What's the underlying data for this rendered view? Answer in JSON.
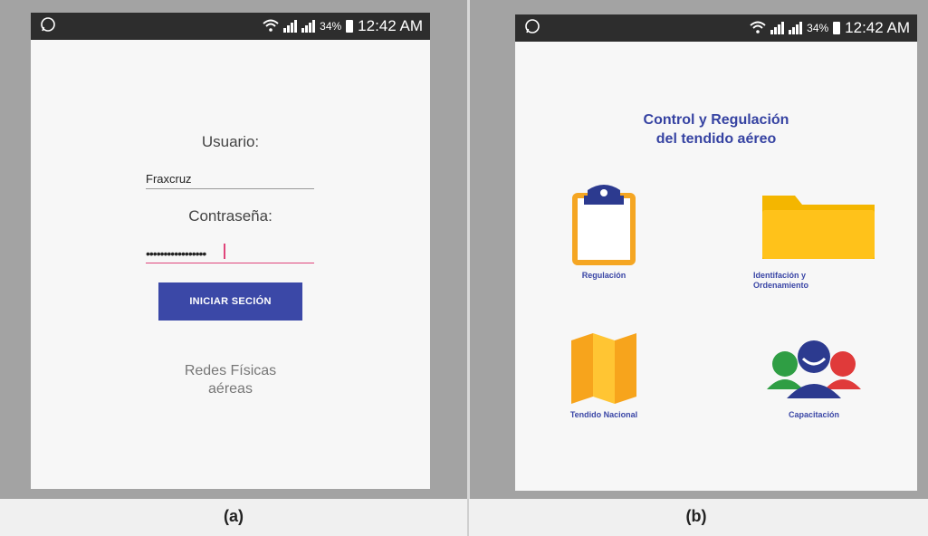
{
  "panel_a": {
    "status": {
      "left_icon": "whatsapp-icon",
      "battery": "34%",
      "time": "12:42 AM"
    },
    "login": {
      "user_label": "Usuario:",
      "user_value": "Fraxcruz",
      "pass_label": "Contraseña:",
      "pass_value": "•••••••••••••••••",
      "button_label": "INICIAR SECIÓN",
      "footer_line1": "Redes Físicas",
      "footer_line2": "aéreas"
    },
    "caption": "(a)"
  },
  "panel_b": {
    "status": {
      "left_icon": "whatsapp-icon",
      "battery": "34%",
      "time": "12:42 AM"
    },
    "title_line1": "Control y Regulación",
    "title_line2": "del tendido aéreo",
    "items": [
      {
        "label": "Regulación",
        "icon": "clipboard-icon"
      },
      {
        "label_line1": "Identifación y",
        "label_line2": "Ordenamiento",
        "icon": "folder-icon"
      },
      {
        "label": "Tendido Nacional",
        "icon": "map-icon"
      },
      {
        "label": "Capacitación",
        "icon": "people-icon"
      }
    ],
    "caption": "(b)"
  },
  "colors": {
    "accent": "#3b48a7",
    "pink": "#e0457b",
    "orange": "#f5a623",
    "yellow": "#ffc21a"
  }
}
